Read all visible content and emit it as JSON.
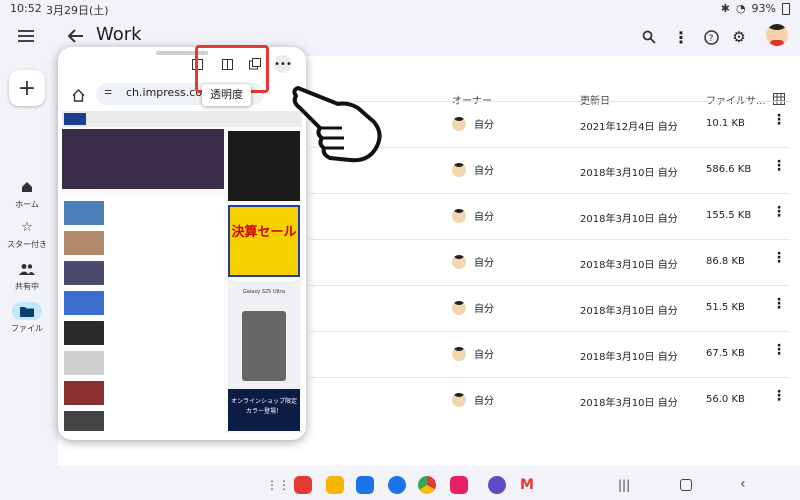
{
  "statusbar": {
    "time": "10:52",
    "date": "3月29日(土)",
    "battery": "93%"
  },
  "appbar": {
    "title": "Work"
  },
  "rail": {
    "items": [
      {
        "label": "ホーム"
      },
      {
        "label": "スター付き"
      },
      {
        "label": "共有中"
      },
      {
        "label": "ファイル"
      }
    ]
  },
  "columns": {
    "owner": "オーナー",
    "updated": "更新日",
    "size": "ファイルサ..."
  },
  "files": [
    {
      "owner": "自分",
      "updated": "2021年12月4日 自分",
      "size": "10.1 KB"
    },
    {
      "owner": "自分",
      "updated": "2018年3月10日 自分",
      "size": "586.6 KB"
    },
    {
      "owner": "自分",
      "updated": "2018年3月10日 自分",
      "size": "155.5 KB"
    },
    {
      "owner": "自分",
      "updated": "2018年3月10日 自分",
      "size": "86.8 KB"
    },
    {
      "owner": "自分",
      "updated": "2018年3月10日 自分",
      "size": "51.5 KB"
    },
    {
      "owner": "自分",
      "updated": "2018年3月10日 自分",
      "size": "67.5 KB"
    },
    {
      "owner": "自分",
      "updated": "2018年3月10日 自分",
      "size": "56.0 KB"
    }
  ],
  "popup": {
    "url": "ch.impress.co.j",
    "tooltip": "透明度",
    "ad1": "決算セール",
    "ad2": "オンラインショップ限定カラー登場！",
    "ad2_brand": "Galaxy S25 Ultra"
  },
  "colors": {
    "highlight": "#e53935",
    "accent": "#c2e7ff"
  }
}
